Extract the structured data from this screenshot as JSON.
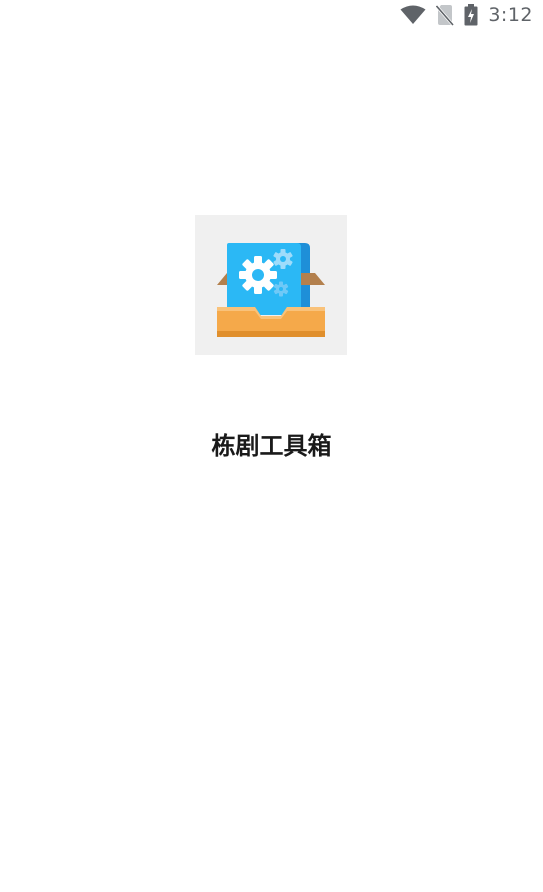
{
  "status_bar": {
    "time": "3:12",
    "icons": [
      "wifi-icon",
      "no-sim-icon",
      "battery-charging-icon"
    ],
    "icon_color": "#5f6368"
  },
  "splash": {
    "app_name": "栋剧工具箱",
    "icon": "toolbox-gear-icon",
    "colors": {
      "card_blue": "#29b6f6",
      "tray_orange": "#f5a94a",
      "background": "#ffffff"
    }
  }
}
